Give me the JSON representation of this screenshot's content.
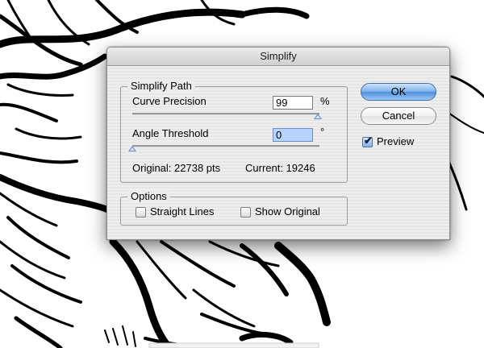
{
  "dialog": {
    "title": "Simplify",
    "simplify_path": {
      "legend": "Simplify Path",
      "curve_precision": {
        "label": "Curve Precision",
        "value": "99",
        "unit": "%",
        "level": 0.99
      },
      "angle_threshold": {
        "label": "Angle Threshold",
        "value": "0",
        "unit": "°",
        "level": 0.0
      },
      "stats": {
        "original": "Original: 22738 pts",
        "current": "Current: 19246"
      }
    },
    "options": {
      "legend": "Options",
      "straight_lines": {
        "label": "Straight Lines",
        "checked": false
      },
      "show_original": {
        "label": "Show Original",
        "checked": false
      }
    },
    "buttons": {
      "ok": "OK",
      "cancel": "Cancel"
    },
    "preview": {
      "label": "Preview",
      "checked": true
    }
  },
  "colors": {
    "accent": "#4f8fdc",
    "focus_field": "#b6d4fb"
  }
}
